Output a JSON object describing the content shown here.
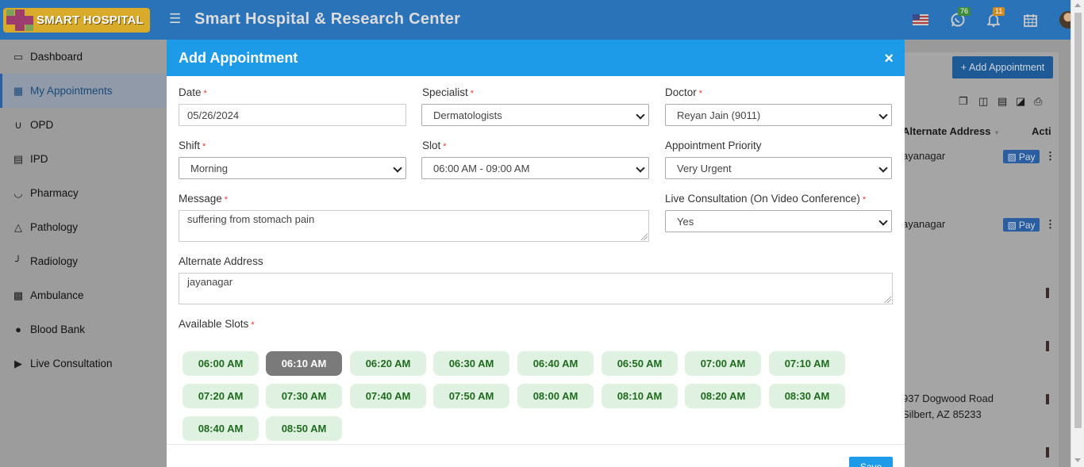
{
  "header": {
    "logo_text": "SMART HOSPITAL",
    "title": "Smart Hospital & Research Center",
    "whatsapp_badge": "76",
    "notification_badge": "11",
    "icons": [
      "menu-icon",
      "us-flag-icon",
      "whatsapp-icon",
      "bell-icon",
      "calendar-icon",
      "avatar"
    ]
  },
  "sidebar": {
    "items": [
      {
        "label": "Dashboard",
        "icon": "monitor-icon"
      },
      {
        "label": "My Appointments",
        "icon": "hospital-icon",
        "active": true
      },
      {
        "label": "OPD",
        "icon": "stethoscope-icon"
      },
      {
        "label": "IPD",
        "icon": "bed-icon"
      },
      {
        "label": "Pharmacy",
        "icon": "mortar-pestle-icon"
      },
      {
        "label": "Pathology",
        "icon": "flask-icon"
      },
      {
        "label": "Radiology",
        "icon": "microscope-icon"
      },
      {
        "label": "Ambulance",
        "icon": "ambulance-icon"
      },
      {
        "label": "Blood Bank",
        "icon": "tint-icon"
      },
      {
        "label": "Live Consultation",
        "icon": "video-icon"
      }
    ]
  },
  "background": {
    "add_button": "Add Appointment",
    "col_alt_address": "Alternate Address",
    "col_action": "Acti",
    "rows": [
      {
        "address": "ayanagar",
        "pay": "Pay"
      },
      {
        "address": "ayanagar",
        "pay": "Pay"
      },
      {
        "address_line1": "937 Dogwood Road",
        "address_line2": "Silbert, AZ 85233"
      }
    ]
  },
  "modal": {
    "title": "Add Appointment",
    "close": "×",
    "fields": {
      "date": {
        "label": "Date",
        "value": "05/26/2024"
      },
      "specialist": {
        "label": "Specialist",
        "value": "Dermatologists"
      },
      "doctor": {
        "label": "Doctor",
        "value": "Reyan Jain (9011)"
      },
      "shift": {
        "label": "Shift",
        "value": "Morning"
      },
      "slot": {
        "label": "Slot",
        "value": "06:00 AM - 09:00 AM"
      },
      "priority": {
        "label": "Appointment Priority",
        "value": "Very Urgent"
      },
      "message": {
        "label": "Message",
        "value": "suffering from stomach pain"
      },
      "live_consult": {
        "label": "Live Consultation (On Video Conference)",
        "value": "Yes"
      },
      "alt_address": {
        "label": "Alternate Address",
        "value": "jayanagar"
      }
    },
    "slots_label": "Available Slots",
    "slots": [
      "06:00 AM",
      "06:10 AM",
      "06:20 AM",
      "06:30 AM",
      "06:40 AM",
      "06:50 AM",
      "07:00 AM",
      "07:10 AM",
      "07:20 AM",
      "07:30 AM",
      "07:40 AM",
      "07:50 AM",
      "08:00 AM",
      "08:10 AM",
      "08:20 AM",
      "08:30 AM",
      "08:40 AM",
      "08:50 AM"
    ],
    "selected_slot": "06:10 AM",
    "save_label": "Save"
  },
  "colors": {
    "header": "#2a73b8",
    "modal_header": "#1e9be8",
    "slot_bg": "#dff1e0",
    "slot_text": "#1e6b1e",
    "slot_selected": "#7a7a7a"
  }
}
